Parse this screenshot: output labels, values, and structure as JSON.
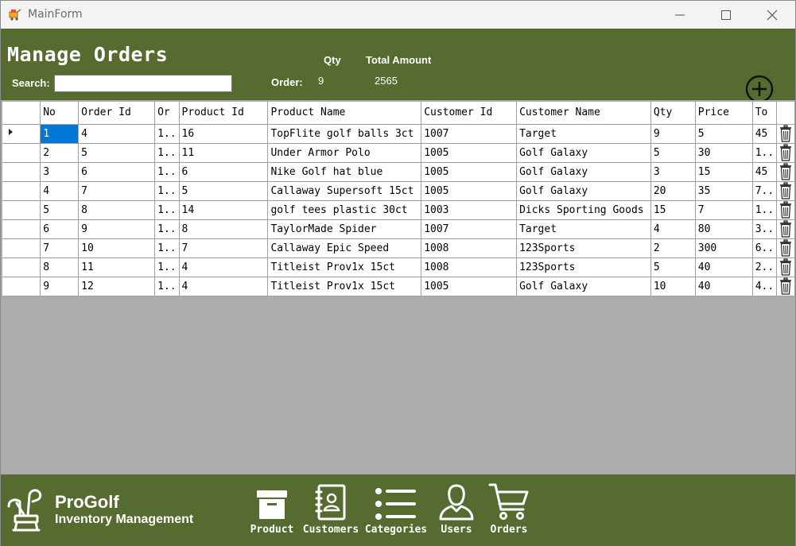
{
  "window": {
    "title": "MainForm"
  },
  "header": {
    "title": "Manage Orders",
    "search_label": "Search:",
    "search_value": "",
    "qty_label": "Qty",
    "total_label": "Total Amount",
    "order_label": "Order:",
    "qty_value": "9",
    "total_value": "2565"
  },
  "grid": {
    "columns": [
      "No",
      "Order Id",
      "Or",
      "Product Id",
      "Product Name",
      "Customer Id",
      "Customer Name",
      "Qty",
      "Price",
      "To"
    ],
    "rows": [
      [
        "1",
        "4",
        "1..",
        "16",
        "TopFlite golf balls 3ct",
        "1007",
        "Target",
        "9",
        "5",
        "45"
      ],
      [
        "2",
        "5",
        "1..",
        "11",
        "Under Armor Polo",
        "1005",
        "Golf Galaxy",
        "5",
        "30",
        "1.."
      ],
      [
        "3",
        "6",
        "1..",
        "6",
        "Nike Golf hat blue",
        "1005",
        "Golf Galaxy",
        "3",
        "15",
        "45"
      ],
      [
        "4",
        "7",
        "1..",
        "5",
        "Callaway Supersoft 15ct",
        "1005",
        "Golf Galaxy",
        "20",
        "35",
        "7.."
      ],
      [
        "5",
        "8",
        "1..",
        "14",
        "golf tees plastic 30ct",
        "1003",
        "Dicks Sporting Goods",
        "15",
        "7",
        "1.."
      ],
      [
        "6",
        "9",
        "1..",
        "8",
        "TaylorMade Spider",
        "1007",
        "Target",
        "4",
        "80",
        "3.."
      ],
      [
        "7",
        "10",
        "1..",
        "7",
        "Callaway Epic Speed",
        "1008",
        "123Sports",
        "2",
        "300",
        "6.."
      ],
      [
        "8",
        "11",
        "1..",
        "4",
        "Titleist Prov1x 15ct",
        "1008",
        "123Sports",
        "5",
        "40",
        "2.."
      ],
      [
        "9",
        "12",
        "1..",
        "4",
        "Titleist Prov1x 15ct",
        "1005",
        "Golf Galaxy",
        "10",
        "40",
        "4.."
      ]
    ],
    "selected_row": 0
  },
  "footer": {
    "brand_name": "ProGolf",
    "brand_sub": "Inventory Management",
    "nav": [
      {
        "label": "Product",
        "icon": "archive-box-icon"
      },
      {
        "label": "Customers",
        "icon": "contact-book-icon"
      },
      {
        "label": "Categories",
        "icon": "list-icon"
      },
      {
        "label": "Users",
        "icon": "user-icon"
      },
      {
        "label": "Orders",
        "icon": "shopping-cart-icon"
      }
    ]
  },
  "colors": {
    "theme": "#556b2f",
    "selection": "#0078d7",
    "grid_background": "#acacac"
  }
}
